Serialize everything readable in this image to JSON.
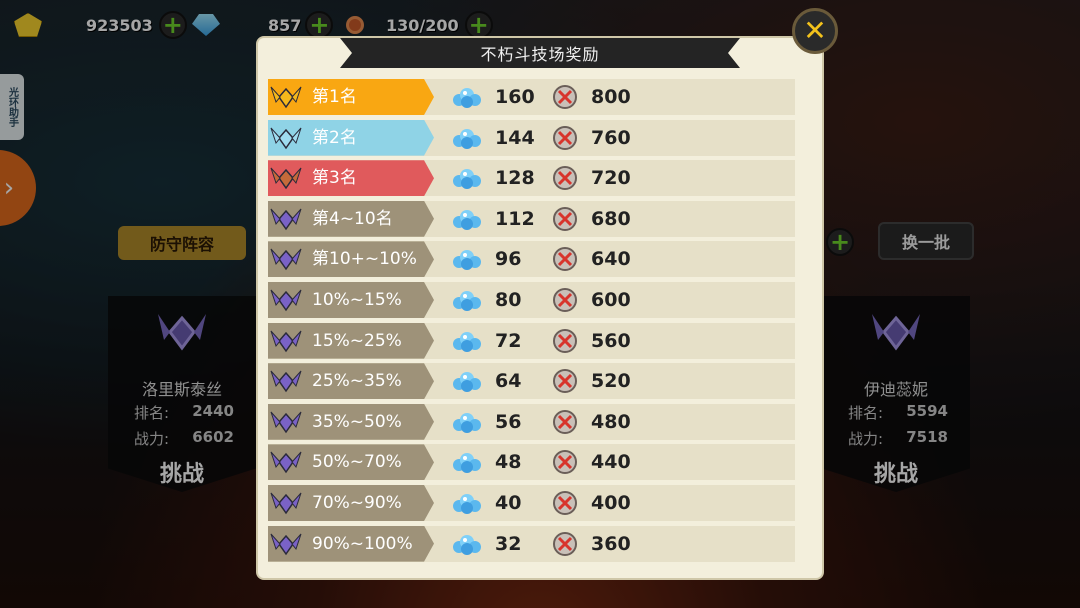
{
  "colors": {
    "rank1": "#f9a712",
    "rank2": "#8fd3e6",
    "rank3": "#e05a5c",
    "rank_default": "#9e9279",
    "row_bg": "#e6e0c8",
    "panel_bg": "#f3efdc"
  },
  "topbar": {
    "gold": "923503",
    "diamonds": "857",
    "stamina": "130/200"
  },
  "side": {
    "helper_label": "光环助手"
  },
  "background": {
    "defend_label": "防守阵容",
    "swap_label": "换一批",
    "left_card": {
      "name": "洛里斯泰丝",
      "rank_label": "排名:",
      "rank": "2440",
      "power_label": "战力:",
      "power": "6602",
      "challenge": "挑战"
    },
    "right_card": {
      "name": "伊迪蕊妮",
      "rank_label": "排名:",
      "rank": "5594",
      "power_label": "战力:",
      "power": "7518",
      "challenge": "挑战"
    }
  },
  "modal": {
    "title": "不朽斗技场奖励",
    "close_icon": "close-x-icon",
    "rewards": [
      {
        "rank": "第1名",
        "diamonds": "160",
        "medals": "800",
        "tier": "gold"
      },
      {
        "rank": "第2名",
        "diamonds": "144",
        "medals": "760",
        "tier": "silver"
      },
      {
        "rank": "第3名",
        "diamonds": "128",
        "medals": "720",
        "tier": "bronze"
      },
      {
        "rank": "第4~10名",
        "diamonds": "112",
        "medals": "680",
        "tier": "purple"
      },
      {
        "rank": "第10+~10%",
        "diamonds": "96",
        "medals": "640",
        "tier": "purple"
      },
      {
        "rank": "10%~15%",
        "diamonds": "80",
        "medals": "600",
        "tier": "purple"
      },
      {
        "rank": "15%~25%",
        "diamonds": "72",
        "medals": "560",
        "tier": "purple"
      },
      {
        "rank": "25%~35%",
        "diamonds": "64",
        "medals": "520",
        "tier": "purple"
      },
      {
        "rank": "35%~50%",
        "diamonds": "56",
        "medals": "480",
        "tier": "purple"
      },
      {
        "rank": "50%~70%",
        "diamonds": "48",
        "medals": "440",
        "tier": "purple"
      },
      {
        "rank": "70%~90%",
        "diamonds": "40",
        "medals": "400",
        "tier": "purple"
      },
      {
        "rank": "90%~100%",
        "diamonds": "32",
        "medals": "360",
        "tier": "purple"
      }
    ]
  }
}
